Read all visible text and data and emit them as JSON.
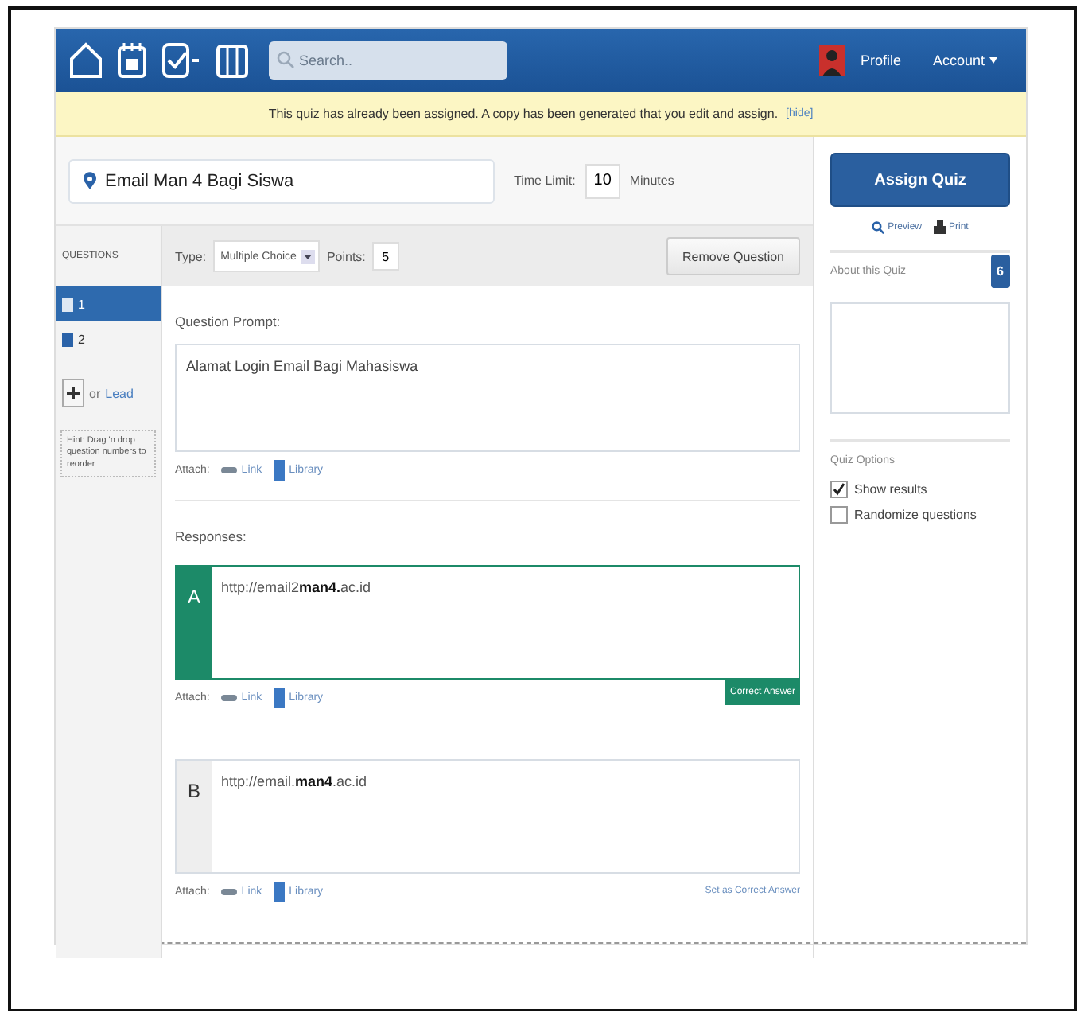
{
  "nav": {
    "search_placeholder": "Search..",
    "profile": "Profile",
    "account": "Account"
  },
  "notice": {
    "text": "This quiz has already been assigned. A copy has been generated that you edit and assign.",
    "link": "[hide]"
  },
  "quiz": {
    "title": "Email Man 4 Bagi Siswa",
    "time_limit_label": "Time Limit:",
    "time_limit": "10",
    "time_unit": "Minutes"
  },
  "questions": {
    "heading": "QUESTIONS",
    "items": [
      {
        "label": "1",
        "selected": true
      },
      {
        "label": "2",
        "selected": false
      }
    ],
    "add_or": "or",
    "lead": "Lead",
    "hint": "Hint: Drag 'n drop question numbers to reorder"
  },
  "editor": {
    "type_label": "Type:",
    "type": "Multiple Choice",
    "points_label": "Points:",
    "points": "5",
    "remove": "Remove Question",
    "prompt_label": "Question Prompt:",
    "prompt": "Alamat Login Email Bagi Mahasiswa",
    "attach": {
      "label": "Attach:",
      "link": "Link",
      "library": "Library"
    },
    "responses_label": "Responses:",
    "responses": [
      {
        "letter": "A",
        "text": "http://email2**man4.**ac.id",
        "correct": true,
        "correct_label": "Correct Answer",
        "attach": {
          "label": "Attach:",
          "link": "Link",
          "library": "Library"
        }
      },
      {
        "letter": "B",
        "text": "http://email.**man4**.ac.id",
        "correct": false,
        "correct_label": "Set as Correct Answer",
        "attach": {
          "label": "Attach:",
          "link": "Link",
          "library": "Library"
        }
      }
    ]
  },
  "sidebar": {
    "assign": "Assign Quiz",
    "preview": "Preview",
    "print": "Print",
    "about": "About this Quiz",
    "about_badge": "6",
    "options_label": "Quiz Options",
    "options": [
      {
        "label": "Show results",
        "checked": true
      },
      {
        "label": "Randomize questions",
        "checked": false
      }
    ]
  }
}
